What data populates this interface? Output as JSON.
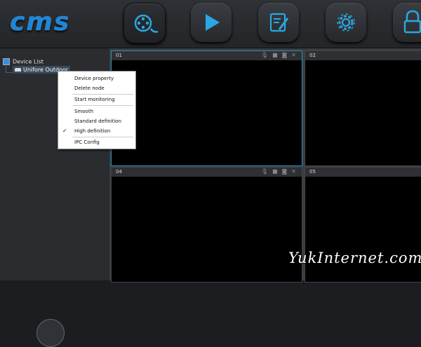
{
  "app": {
    "logo_text": "cms"
  },
  "nav": {
    "buttons": [
      {
        "name": "monitor-button",
        "icon": "film-reel-icon",
        "active": true
      },
      {
        "name": "playback-button",
        "icon": "play-icon",
        "active": false
      },
      {
        "name": "log-button",
        "icon": "clipboard-pen-icon",
        "active": false
      },
      {
        "name": "settings-button",
        "icon": "gear-icon",
        "active": false
      },
      {
        "name": "lock-button",
        "icon": "lock-icon",
        "active": false
      }
    ]
  },
  "tree": {
    "root_label": "Device List",
    "child_label": "Unifore Outdoor"
  },
  "cells": [
    {
      "num": "01"
    },
    {
      "num": "02"
    },
    {
      "num": "04"
    },
    {
      "num": "05"
    }
  ],
  "context_menu": {
    "items": [
      {
        "label": "Device property",
        "checked": false
      },
      {
        "label": "Delete node",
        "checked": false
      },
      {
        "label": "Start monitoring",
        "checked": false
      },
      {
        "label": "Smooth",
        "checked": false
      },
      {
        "label": "Standard definition",
        "checked": false
      },
      {
        "label": "High definition",
        "checked": true
      },
      {
        "label": "IPC Config",
        "checked": false
      }
    ],
    "check_glyph": "✓"
  },
  "watermark": "YukInternet.com",
  "colors": {
    "accent": "#2a8fb8",
    "logo": "#1f86d6"
  }
}
